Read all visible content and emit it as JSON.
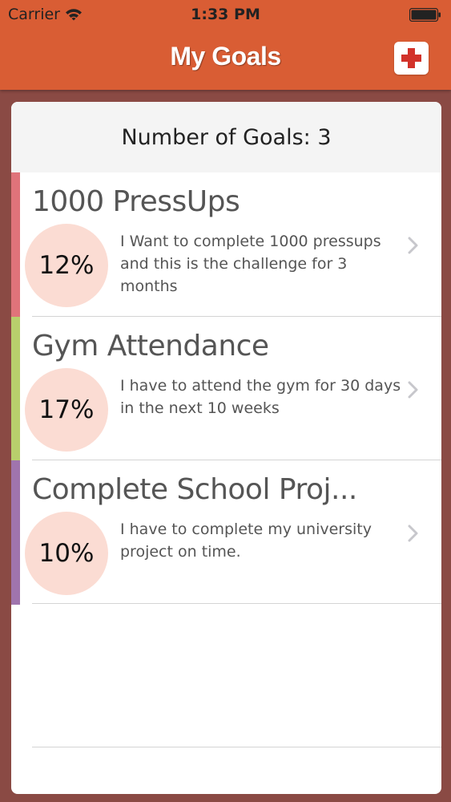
{
  "status_bar": {
    "carrier": "Carrier",
    "time": "1:33 PM"
  },
  "nav": {
    "title": "My Goals",
    "add_icon": "plus-icon"
  },
  "goals_header": {
    "label": "Number of Goals: 3"
  },
  "goals": [
    {
      "title": "1000 PressUps",
      "progress_label": "12%",
      "progress": 0.12,
      "description": "I Want to complete 1000 pressups and this is the challenge for 3 months",
      "color": "#e0737a"
    },
    {
      "title": "Gym Attendance",
      "progress_label": "17%",
      "progress": 0.17,
      "description": "I have to attend the gym for 30 days in the next 10 weeks",
      "color": "#b8cf6c"
    },
    {
      "title": "Complete School Proj...",
      "progress_label": "10%",
      "progress": 0.1,
      "description": "I have to complete my university project on time.",
      "color": "#a074ad"
    }
  ],
  "colors": {
    "nav_background": "#d95d34",
    "page_background": "#8a4a44",
    "progress_circle": "#fbdcd3",
    "add_icon": "#d2322a"
  }
}
